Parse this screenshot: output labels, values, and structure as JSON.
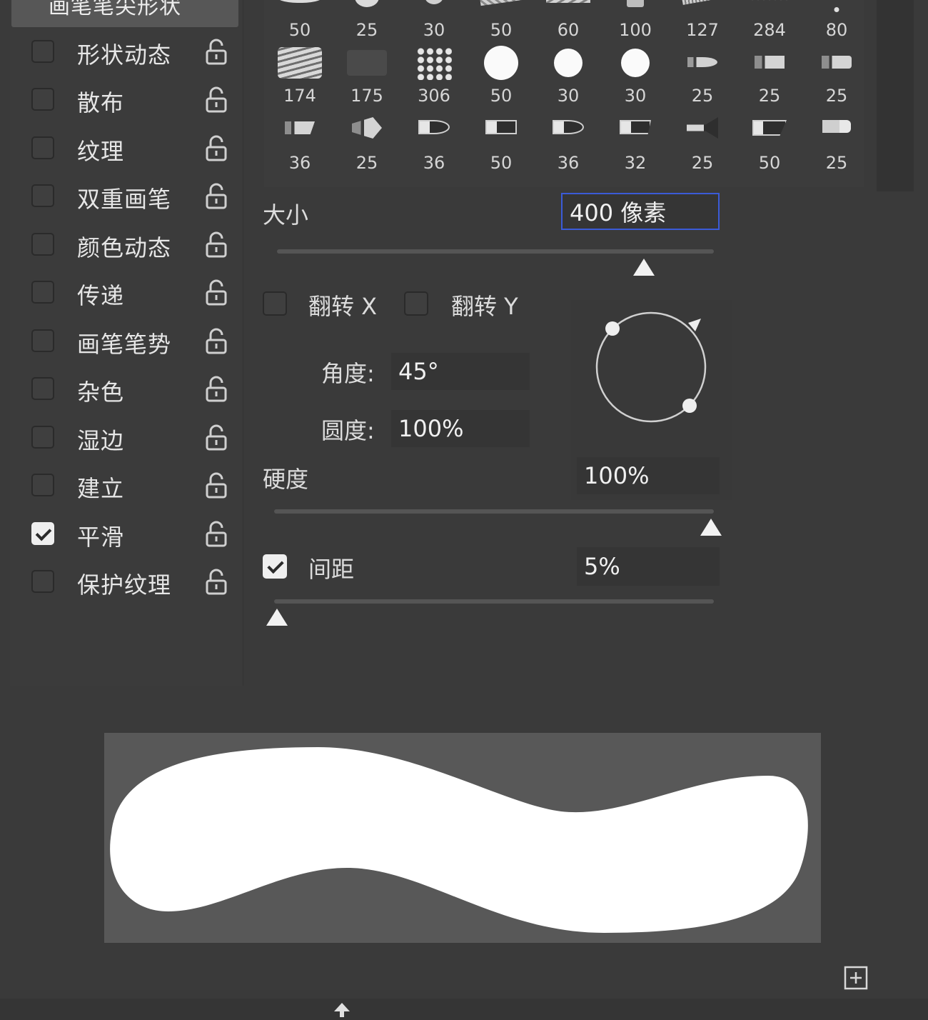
{
  "left_panel": {
    "header": "画笔笔尖形状",
    "options": [
      {
        "label": "形状动态",
        "checked": false
      },
      {
        "label": "散布",
        "checked": false
      },
      {
        "label": "纹理",
        "checked": false
      },
      {
        "label": "双重画笔",
        "checked": false
      },
      {
        "label": "颜色动态",
        "checked": false
      },
      {
        "label": "传递",
        "checked": false
      },
      {
        "label": "画笔笔势",
        "checked": false
      },
      {
        "label": "杂色",
        "checked": false
      },
      {
        "label": "湿边",
        "checked": false
      },
      {
        "label": "建立",
        "checked": false
      },
      {
        "label": "平滑",
        "checked": true
      },
      {
        "label": "保护纹理",
        "checked": false
      }
    ]
  },
  "brush_tips": {
    "row1": [
      "50",
      "25",
      "30",
      "50",
      "60",
      "100",
      "127",
      "284",
      "80"
    ],
    "row2": [
      "174",
      "175",
      "306",
      "50",
      "30",
      "30",
      "25",
      "25",
      "25"
    ],
    "row3": [
      "36",
      "25",
      "36",
      "50",
      "36",
      "32",
      "25",
      "50",
      "25"
    ]
  },
  "controls": {
    "size_label": "大小",
    "size_value": "400 像素",
    "size_fraction": 0.84,
    "flip_x_label": "翻转 X",
    "flip_y_label": "翻转 Y",
    "angle_label": "角度:",
    "angle_value": "45°",
    "roundness_label": "圆度:",
    "roundness_value": "100%",
    "hardness_label": "硬度",
    "hardness_value": "100%",
    "hardness_fraction": 1.0,
    "spacing_label": "间距",
    "spacing_value": "5%",
    "spacing_checked": true,
    "spacing_fraction": 0.0
  },
  "icons": {
    "lock": "unlock-icon",
    "new_brush": "new-brush-icon"
  }
}
